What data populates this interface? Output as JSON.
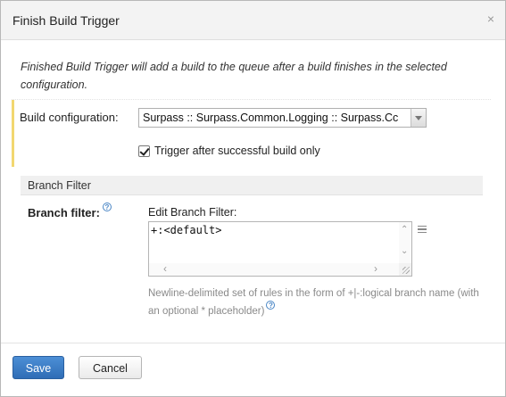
{
  "dialog": {
    "title": "Finish Build Trigger",
    "close_glyph": "×",
    "description": "Finished Build Trigger will add a build to the queue after a build finishes in the selected configuration."
  },
  "form": {
    "build_config_label": "Build configuration:",
    "build_config_value": "Surpass :: Surpass.Common.Logging :: Surpass.Cc",
    "trigger_checkbox_label": "Trigger after successful build only",
    "trigger_checked": true,
    "section_title": "Branch Filter",
    "branch_filter_label": "Branch filter:",
    "edit_branch_label": "Edit Branch Filter:",
    "branch_filter_value": "+:<default>",
    "branch_hint": "Newline-delimited set of rules in the form of +|-:logical branch name (with an optional * placeholder)"
  },
  "footer": {
    "save_label": "Save",
    "cancel_label": "Cancel"
  },
  "colors": {
    "primary_button": "#3a7bc8",
    "highlight_bar": "#f2d770",
    "help_icon": "#4a86c5"
  },
  "icons": {
    "close": "close-icon",
    "dropdown": "chevron-down-icon",
    "help": "help-icon",
    "list": "list-icon",
    "resize": "resize-grip-icon"
  }
}
